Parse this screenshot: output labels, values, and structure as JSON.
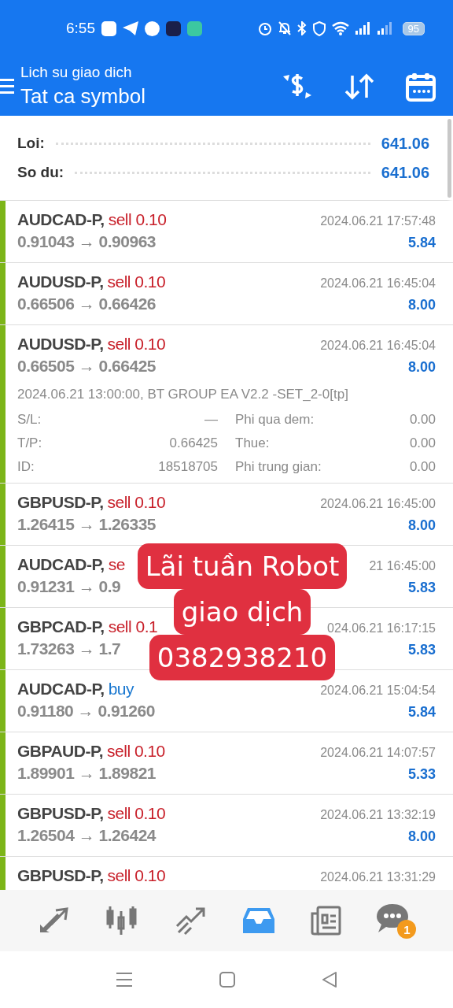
{
  "status_bar": {
    "time": "6:55",
    "battery": "95"
  },
  "header": {
    "subtitle": "Lich su giao dich",
    "title": "Tat ca symbol"
  },
  "summary": [
    {
      "label": "Loi:",
      "value": "641.06"
    },
    {
      "label": "So du:",
      "value": "641.06"
    }
  ],
  "trades": [
    {
      "symbol": "AUDCAD-P,",
      "side": "sell",
      "lot": "0.10",
      "prices": "0.91043 → 0.90963",
      "time": "2024.06.21 17:57:48",
      "profit": "5.84",
      "expanded": false
    },
    {
      "symbol": "AUDUSD-P,",
      "side": "sell",
      "lot": "0.10",
      "prices": "0.66506 → 0.66426",
      "time": "2024.06.21 16:45:04",
      "profit": "8.00",
      "expanded": false
    },
    {
      "symbol": "AUDUSD-P,",
      "side": "sell",
      "lot": "0.10",
      "prices": "0.66505 → 0.66425",
      "time": "2024.06.21 16:45:04",
      "profit": "8.00",
      "expanded": true,
      "comment": "2024.06.21 13:00:00, BT GROUP EA V2.2 -SET_2-0[tp]",
      "details": [
        {
          "label": "S/L:",
          "value": "—"
        },
        {
          "label": "Phi qua dem:",
          "value": "0.00"
        },
        {
          "label": "T/P:",
          "value": "0.66425"
        },
        {
          "label": "Thue:",
          "value": "0.00"
        },
        {
          "label": "ID:",
          "value": "18518705"
        },
        {
          "label": "Phi trung gian:",
          "value": "0.00"
        }
      ]
    },
    {
      "symbol": "GBPUSD-P,",
      "side": "sell",
      "lot": "0.10",
      "prices": "1.26415 → 1.26335",
      "time": "2024.06.21 16:45:00",
      "profit": "8.00",
      "expanded": false
    },
    {
      "symbol": "AUDCAD-P,",
      "side": "se",
      "prices": "0.91231 → 0.9",
      "time": "21 16:45:00",
      "profit": "5.83",
      "expanded": false
    },
    {
      "symbol": "GBPCAD-P,",
      "side": "sell",
      "lot": "0.1",
      "prices": "1.73263 → 1.7",
      "time": "024.06.21 16:17:15",
      "profit": "5.83",
      "expanded": false
    },
    {
      "symbol": "AUDCAD-P,",
      "side": "buy",
      "prices": "0.91180 → 0.91260",
      "time": "2024.06.21 15:04:54",
      "profit": "5.84",
      "expanded": false
    },
    {
      "symbol": "GBPAUD-P,",
      "side": "sell",
      "lot": "0.10",
      "prices": "1.89901 → 1.89821",
      "time": "2024.06.21 14:07:57",
      "profit": "5.33",
      "expanded": false
    },
    {
      "symbol": "GBPUSD-P,",
      "side": "sell",
      "lot": "0.10",
      "prices": "1.26504 → 1.26424",
      "time": "2024.06.21 13:32:19",
      "profit": "8.00",
      "expanded": false
    },
    {
      "symbol": "GBPUSD-P,",
      "side": "sell",
      "lot": "0.10",
      "time": "2024.06.21 13:31:29",
      "expanded": false
    }
  ],
  "overlay": [
    "Lãi tuần Robot",
    "giao dịch",
    "0382938210"
  ],
  "nav": [
    {
      "kind": "quotes",
      "selected": false
    },
    {
      "kind": "chart",
      "selected": false
    },
    {
      "kind": "trade",
      "selected": false
    },
    {
      "kind": "history",
      "selected": true
    },
    {
      "kind": "news",
      "selected": false
    },
    {
      "kind": "chat",
      "selected": false,
      "badge": "1"
    }
  ]
}
